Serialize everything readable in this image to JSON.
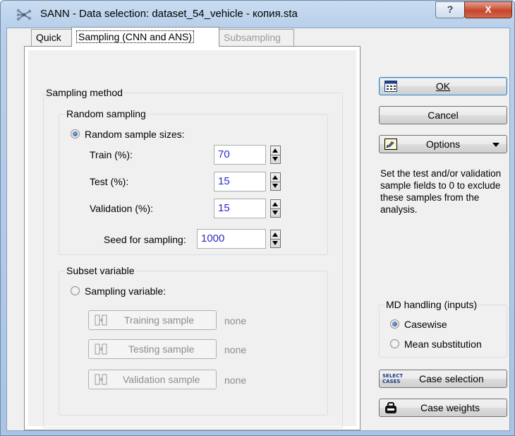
{
  "window": {
    "title": "SANN - Data selection: dataset_54_vehicle - копия.sta",
    "help_label": "?",
    "close_label": "X"
  },
  "tabs": [
    {
      "label": "Quick",
      "state": "normal"
    },
    {
      "label": "Sampling (CNN and ANS)",
      "state": "active"
    },
    {
      "label": "Subsampling",
      "state": "disabled"
    }
  ],
  "sampling_method": {
    "title": "Sampling method",
    "random_sampling": {
      "title": "Random sampling",
      "radio_label": "Random sample sizes:",
      "selected": true,
      "fields": [
        {
          "label": "Train (%):",
          "value": "70"
        },
        {
          "label": "Test (%):",
          "value": "15"
        },
        {
          "label": "Validation (%):",
          "value": "15"
        }
      ],
      "seed": {
        "label": "Seed for sampling:",
        "value": "1000"
      }
    },
    "subset_variable": {
      "title": "Subset variable",
      "radio_label": "Sampling variable:",
      "selected": false,
      "samples": [
        {
          "button": "Training sample",
          "value": "none"
        },
        {
          "button": "Testing sample",
          "value": "none"
        },
        {
          "button": "Validation sample",
          "value": "none"
        }
      ]
    }
  },
  "buttons": {
    "ok": "OK",
    "cancel": "Cancel",
    "options": "Options",
    "case_selection": "Case selection",
    "case_weights": "Case weights",
    "select_cases_icon_text": "SELECT CASES"
  },
  "description": "Set the test and/or validation sample fields to 0 to exclude these samples from the analysis.",
  "md_handling": {
    "title": "MD handling (inputs)",
    "options": [
      {
        "label": "Casewise",
        "selected": true
      },
      {
        "label": "Mean substitution",
        "selected": false
      }
    ]
  },
  "colors": {
    "value_text": "#2a2cc7",
    "disabled_text": "#8d8d8d"
  }
}
